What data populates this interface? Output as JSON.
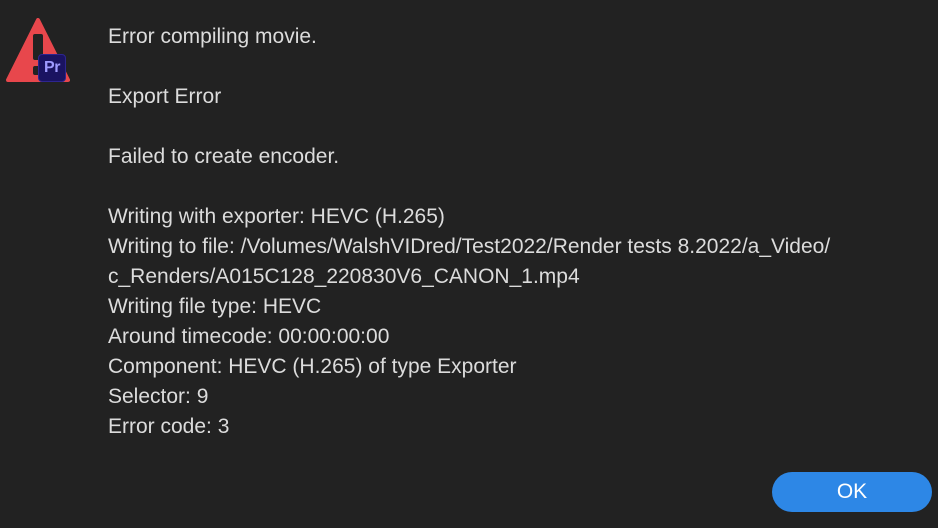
{
  "dialog": {
    "app_badge": "Pr",
    "icons": {
      "alert": "warning-triangle-icon",
      "app": "premiere-pro-app-icon"
    },
    "messages": {
      "title": "Error compiling movie.",
      "subtitle": "Export Error",
      "reason": "Failed to create encoder.",
      "details": [
        "Writing with exporter: HEVC (H.265)",
        "Writing to file: /Volumes/WalshVIDred/Test2022/Render tests 8.2022/a_Video/",
        "c_Renders/A015C128_220830V6_CANON_1.mp4",
        "Writing file type: HEVC",
        "Around timecode: 00:00:00:00",
        "Component: HEVC (H.265) of type Exporter",
        "Selector: 9",
        "Error code: 3"
      ]
    },
    "ok_label": "OK",
    "colors": {
      "background": "#222222",
      "text": "#dcdcdc",
      "alert_red": "#e8474c",
      "button_blue": "#2d87e6",
      "badge_bg": "#1a1361",
      "badge_text": "#9f9bff"
    }
  }
}
